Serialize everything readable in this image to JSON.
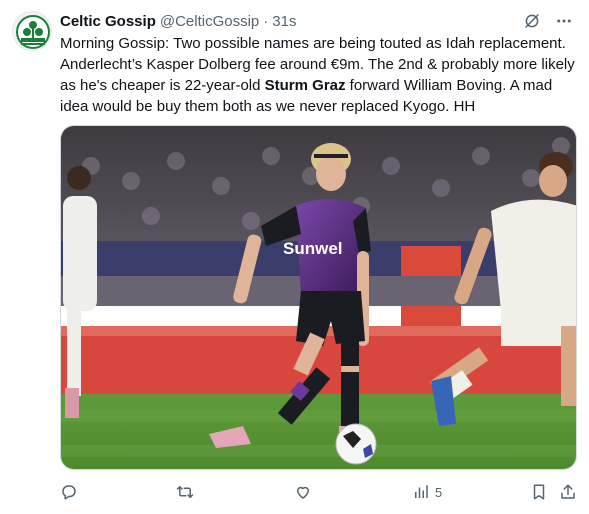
{
  "tweet": {
    "display_name": "Celtic Gossip",
    "handle": "@CelticGossip",
    "separator": "·",
    "time": "31s",
    "text_parts": [
      "Morning Gossip: Two possible names are being touted as Idah replacement. Anderlecht’s Kasper Dolberg fee around €9m. The 2nd & probably more likely as he's cheaper is 22-year-old ",
      "Sturm Graz",
      " forward William Boving. A mad idea would be buy them both as we never replaced Kyogo. HH"
    ]
  },
  "media": {
    "jersey_sponsor": "Sunwel"
  },
  "actions": {
    "views_count": "5"
  },
  "icons": {
    "grok": "grok-icon",
    "more": "more-icon",
    "reply": "reply-icon",
    "retweet": "retweet-icon",
    "like": "like-icon",
    "views": "views-icon",
    "bookmark": "bookmark-icon",
    "share": "share-icon"
  },
  "colors": {
    "text": "#0f1419",
    "secondary": "#536471",
    "avatar_green": "#1a7f3b",
    "kit_purple": "#5a2b84"
  }
}
